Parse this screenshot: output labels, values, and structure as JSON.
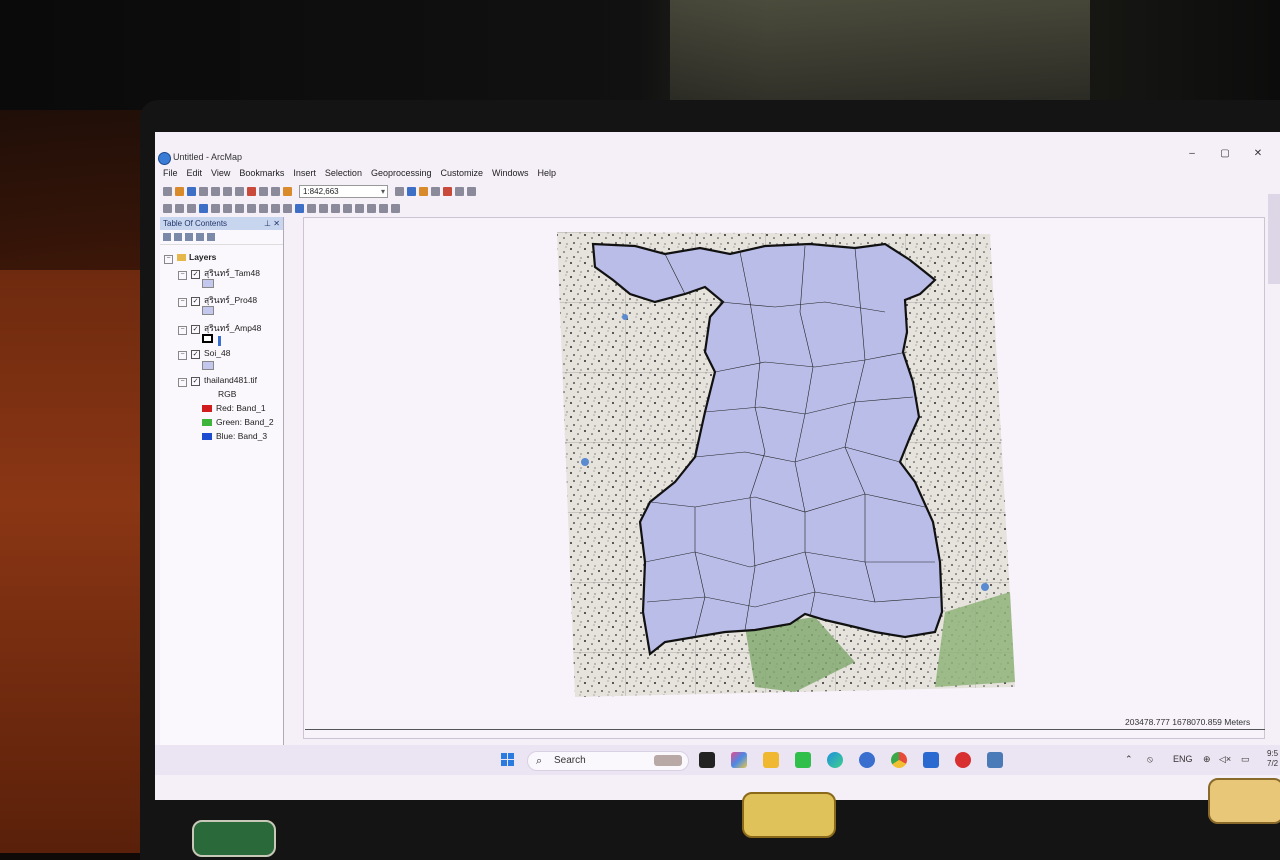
{
  "window": {
    "title": "Untitled - ArcMap",
    "controls": [
      "–",
      "▢",
      "✕"
    ]
  },
  "menu": [
    "File",
    "Edit",
    "View",
    "Bookmarks",
    "Insert",
    "Selection",
    "Geoprocessing",
    "Customize",
    "Windows",
    "Help"
  ],
  "toolbar": {
    "scale_value": "1:842,663"
  },
  "toc": {
    "title": "Table Of Contents",
    "root": "Layers",
    "layers": [
      {
        "name": "สุรินทร์_Tam48"
      },
      {
        "name": "สุรินทร์_Pro48"
      },
      {
        "name": "สุรินทร์_Amp48"
      },
      {
        "name": "Soi_48"
      },
      {
        "name": "thailand481.tif"
      }
    ],
    "raster": {
      "composite": "RGB",
      "bands": [
        {
          "label": "Red:   Band_1",
          "color": "#d01c1c"
        },
        {
          "label": "Green: Band_2",
          "color": "#3fb43a"
        },
        {
          "label": "Blue:  Band_3",
          "color": "#1c4ad0"
        }
      ]
    }
  },
  "status": {
    "coordinates": "203478.777  1678070.859 Meters"
  },
  "taskbar": {
    "search_label": "Search",
    "tray_lang": "ENG",
    "clock_time": "9:5",
    "clock_date": "7/2"
  },
  "colors": {
    "polygon_fill": "#b9bde8",
    "polygon_stroke": "#111111",
    "toc_header": "#c7d5ee"
  }
}
